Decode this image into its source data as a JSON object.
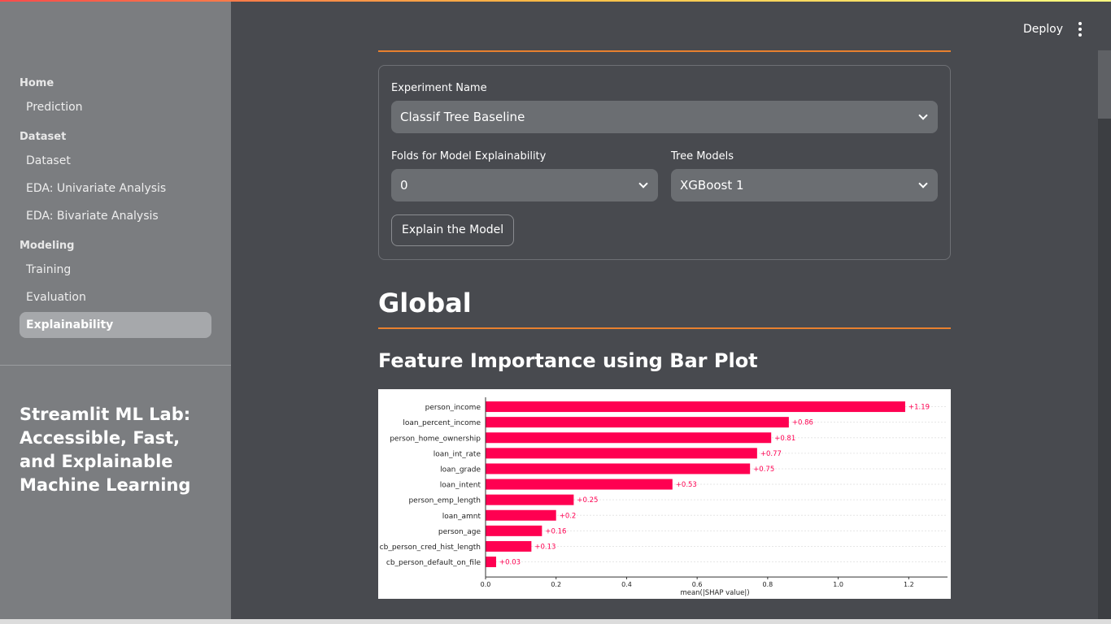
{
  "header": {
    "deploy_label": "Deploy"
  },
  "sidebar": {
    "sections": [
      {
        "title": "Home",
        "items": [
          {
            "label": "Prediction",
            "active": false
          }
        ]
      },
      {
        "title": "Dataset",
        "items": [
          {
            "label": "Dataset",
            "active": false
          },
          {
            "label": "EDA: Univariate Analysis",
            "active": false
          },
          {
            "label": "EDA: Bivariate Analysis",
            "active": false
          }
        ]
      },
      {
        "title": "Modeling",
        "items": [
          {
            "label": "Training",
            "active": false
          },
          {
            "label": "Evaluation",
            "active": false
          },
          {
            "label": "Explainability",
            "active": true
          }
        ]
      }
    ],
    "app_title": "Streamlit ML Lab: Accessible, Fast, and Explainable Machine Learning"
  },
  "form": {
    "experiment_label": "Experiment Name",
    "experiment_value": "Classif Tree Baseline",
    "folds_label": "Folds for Model Explainability",
    "folds_value": "0",
    "tree_models_label": "Tree Models",
    "tree_models_value": "XGBoost 1",
    "explain_button": "Explain the Model"
  },
  "main": {
    "global_heading": "Global",
    "feature_heading": "Feature Importance using Bar Plot"
  },
  "chart_data": {
    "type": "bar",
    "orientation": "horizontal",
    "categories": [
      "person_income",
      "loan_percent_income",
      "person_home_ownership",
      "loan_int_rate",
      "loan_grade",
      "loan_intent",
      "person_emp_length",
      "loan_amnt",
      "person_age",
      "cb_person_cred_hist_length",
      "cb_person_default_on_file"
    ],
    "values": [
      1.19,
      0.86,
      0.81,
      0.77,
      0.75,
      0.53,
      0.25,
      0.2,
      0.16,
      0.13,
      0.03
    ],
    "value_labels": [
      "+1.19",
      "+0.86",
      "+0.81",
      "+0.77",
      "+0.75",
      "+0.53",
      "+0.25",
      "+0.2",
      "+0.16",
      "+0.13",
      "+0.03"
    ],
    "xlabel": "mean(|SHAP value|)",
    "xticks": [
      "0.0",
      "0.2",
      "0.4",
      "0.6",
      "0.8",
      "1.0",
      "1.2"
    ],
    "xlim": [
      0,
      1.31
    ],
    "bar_color": "#ff0051",
    "grid": false
  }
}
